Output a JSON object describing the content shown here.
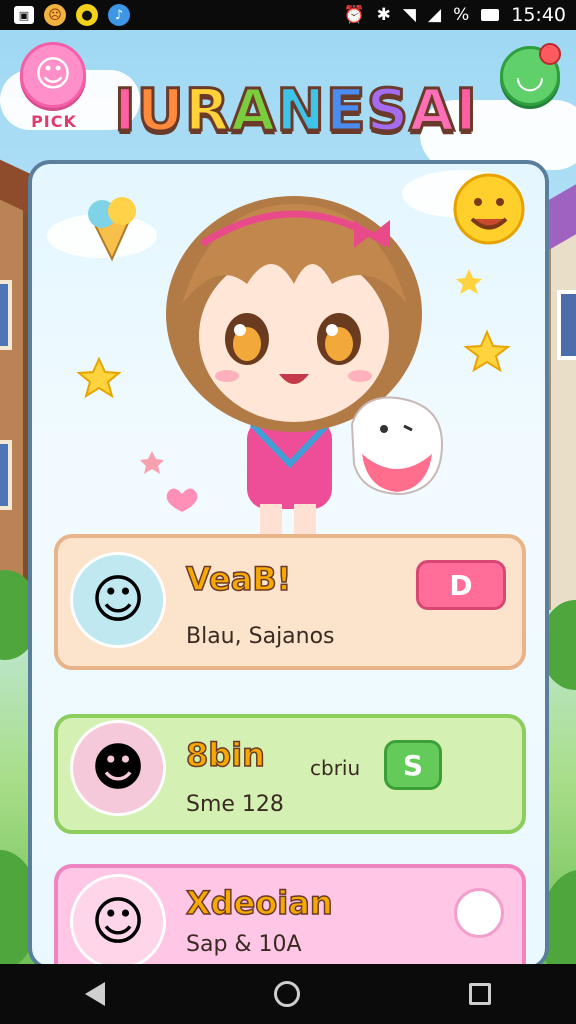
{
  "status_bar": {
    "time": "15:40",
    "battery_text": "%",
    "icons": [
      "gallery-icon",
      "emoji-icon",
      "coin-icon",
      "bird-icon",
      "alarm-icon",
      "bluetooth-icon",
      "wifi-icon",
      "signal-icon",
      "battery-icon"
    ]
  },
  "header": {
    "pick_label": "PICK",
    "title_letters": [
      "I",
      "U",
      "R",
      "A",
      "N",
      "E",
      "S",
      "A",
      "I"
    ],
    "title_colors": [
      "#ff5fa0",
      "#ff8a3c",
      "#ffd23a",
      "#7ccd3e",
      "#3fc4e8",
      "#4a8cf0",
      "#a46cf0",
      "#ff6fb6",
      "#ff5fa0"
    ]
  },
  "cards": [
    {
      "name": "VeaB!",
      "subtitle": "Blau, Sajanos",
      "button_label": "D"
    },
    {
      "name": "8bin",
      "extra": "cbriu",
      "subtitle": "Sme 128",
      "button_label": "S"
    },
    {
      "name": "Xdeoian",
      "subtitle": "Sap & 10A"
    }
  ],
  "colors": {
    "pink_accent": "#ff6d98",
    "green_accent": "#64cb5a",
    "title_outline": "#6a3a2a"
  }
}
